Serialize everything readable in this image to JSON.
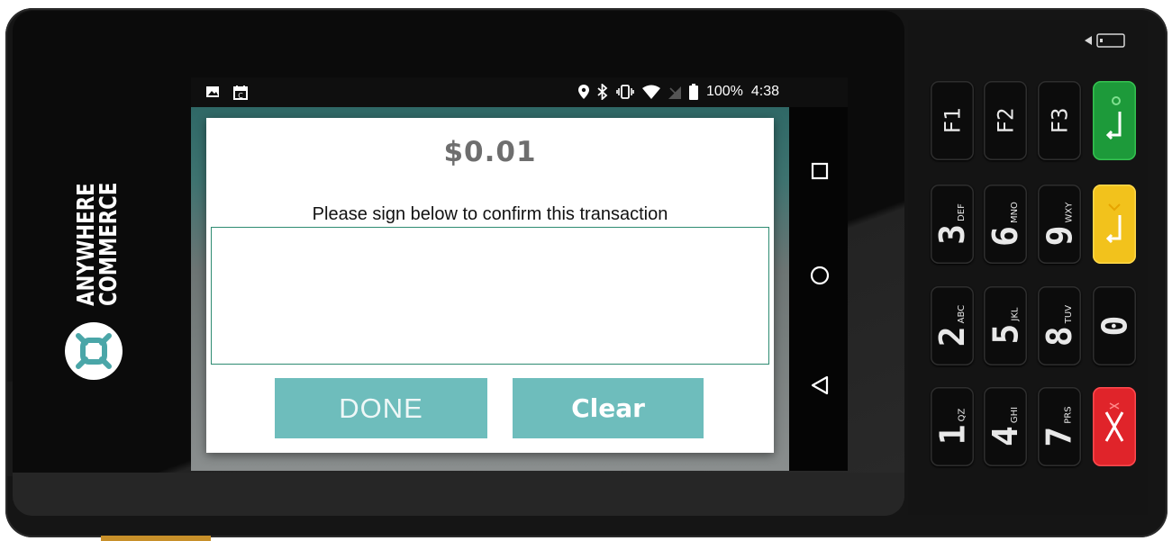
{
  "brand": {
    "line1": "ANYWHERE",
    "line2": "COMMERCE"
  },
  "statusbar": {
    "left_icons": [
      "image-icon",
      "calendar-icon"
    ],
    "right_icons": [
      "location-icon",
      "bluetooth-icon",
      "vibrate-icon",
      "wifi-icon",
      "no-signal-icon",
      "battery-icon"
    ],
    "battery": "100%",
    "time": "4:38"
  },
  "dialog": {
    "amount": "$0.01",
    "prompt": "Please sign below to confirm this transaction",
    "done_label": "DONE",
    "clear_label": "Clear"
  },
  "navbar": {
    "buttons": [
      "recents-button",
      "home-button",
      "back-button"
    ]
  },
  "keypad": {
    "keys": [
      {
        "digit": "F1",
        "letters": ""
      },
      {
        "digit": "F2",
        "letters": ""
      },
      {
        "digit": "F3",
        "letters": ""
      },
      {
        "digit": "3",
        "letters": "DEF"
      },
      {
        "digit": "6",
        "letters": "MNO"
      },
      {
        "digit": "9",
        "letters": "WXY"
      },
      {
        "digit": "2",
        "letters": "ABC"
      },
      {
        "digit": "5",
        "letters": "JKL"
      },
      {
        "digit": "8",
        "letters": "TUV"
      },
      {
        "digit": "0",
        "letters": ""
      },
      {
        "digit": "1",
        "letters": "QZ"
      },
      {
        "digit": "4",
        "letters": "GHI"
      },
      {
        "digit": "7",
        "letters": "PRS"
      }
    ]
  },
  "colors": {
    "accent": "#6ebdbc",
    "pad_border": "#2e8b72",
    "enter": "#1d9a3a",
    "clear_key": "#f2c21c",
    "cancel": "#e0242a"
  }
}
